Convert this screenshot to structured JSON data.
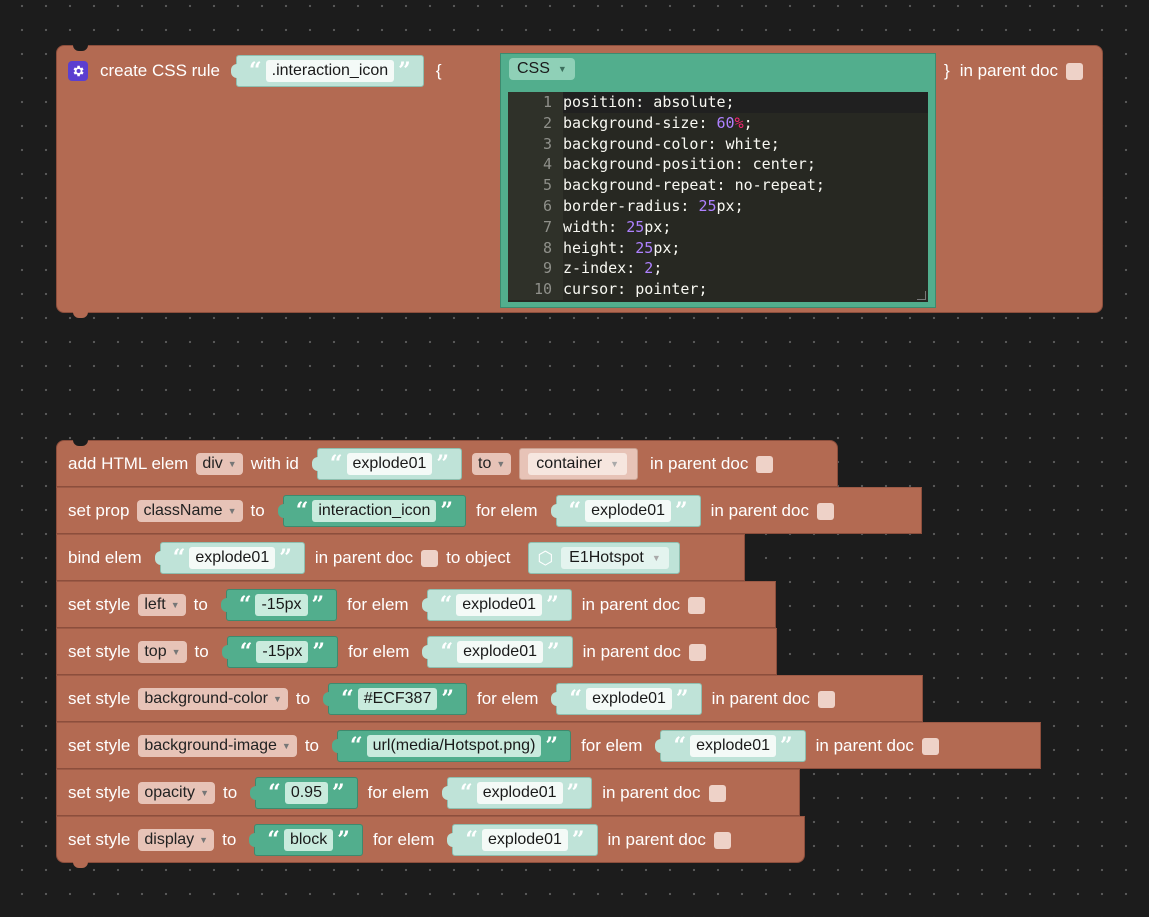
{
  "css_rule_block": {
    "label": "create CSS rule",
    "selector": ".interaction_icon",
    "open_brace": "{",
    "close_brace": "}",
    "language": "CSS",
    "in_parent_doc": "in parent doc",
    "code_lines": [
      {
        "n": "1",
        "parts": [
          [
            "t",
            "position: absolute;"
          ]
        ]
      },
      {
        "n": "2",
        "parts": [
          [
            "t",
            "background-size: "
          ],
          [
            "n",
            "60"
          ],
          [
            "p",
            "%"
          ],
          [
            "t",
            ";"
          ]
        ]
      },
      {
        "n": "3",
        "parts": [
          [
            "t",
            "background-color: white;"
          ]
        ]
      },
      {
        "n": "4",
        "parts": [
          [
            "t",
            "background-position: center;"
          ]
        ]
      },
      {
        "n": "5",
        "parts": [
          [
            "t",
            "background-repeat: no-repeat;"
          ]
        ]
      },
      {
        "n": "6",
        "parts": [
          [
            "t",
            "border-radius: "
          ],
          [
            "n",
            "25"
          ],
          [
            "t",
            "px;"
          ]
        ]
      },
      {
        "n": "7",
        "parts": [
          [
            "t",
            "width: "
          ],
          [
            "n",
            "25"
          ],
          [
            "t",
            "px;"
          ]
        ]
      },
      {
        "n": "8",
        "parts": [
          [
            "t",
            "height: "
          ],
          [
            "n",
            "25"
          ],
          [
            "t",
            "px;"
          ]
        ]
      },
      {
        "n": "9",
        "parts": [
          [
            "t",
            "z-index: "
          ],
          [
            "n",
            "2"
          ],
          [
            "t",
            ";"
          ]
        ]
      },
      {
        "n": "10",
        "parts": [
          [
            "t",
            "cursor: pointer;"
          ]
        ]
      }
    ]
  },
  "stack": {
    "add_html": {
      "label": "add HTML elem",
      "tag": "div",
      "with_id": "with id",
      "id": "explode01",
      "to": "to",
      "target": "container",
      "in_parent_doc": "in parent doc"
    },
    "set_prop": {
      "label": "set prop",
      "prop": "className",
      "to": "to",
      "value": "interaction_icon",
      "for_elem": "for elem",
      "elem": "explode01",
      "in_parent_doc": "in parent doc"
    },
    "bind_elem": {
      "label": "bind elem",
      "elem": "explode01",
      "in_parent_doc": "in parent doc",
      "to_object": "to object",
      "object": "E1Hotspot"
    },
    "styles": [
      {
        "label": "set style",
        "prop": "left",
        "to": "to",
        "value": "-15px",
        "for_elem": "for elem",
        "elem": "explode01",
        "in_parent_doc": "in parent doc"
      },
      {
        "label": "set style",
        "prop": "top",
        "to": "to",
        "value": "-15px",
        "for_elem": "for elem",
        "elem": "explode01",
        "in_parent_doc": "in parent doc"
      },
      {
        "label": "set style",
        "prop": "background-color",
        "to": "to",
        "value": "#ECF387",
        "for_elem": "for elem",
        "elem": "explode01",
        "in_parent_doc": "in parent doc"
      },
      {
        "label": "set style",
        "prop": "background-image",
        "to": "to",
        "value": "url(media/Hotspot.png)",
        "for_elem": "for elem",
        "elem": "explode01",
        "in_parent_doc": "in parent doc"
      },
      {
        "label": "set style",
        "prop": "opacity",
        "to": "to",
        "value": "0.95",
        "for_elem": "for elem",
        "elem": "explode01",
        "in_parent_doc": "in parent doc"
      },
      {
        "label": "set style",
        "prop": "display",
        "to": "to",
        "value": "block",
        "for_elem": "for elem",
        "elem": "explode01",
        "in_parent_doc": "in parent doc"
      }
    ]
  },
  "colors": {
    "block": "#b36a52",
    "text_block_light": "#bfe3d8",
    "text_block_dark": "#52ae8d",
    "editor_bg": "#272822",
    "workspace_bg": "#1c1c1c"
  },
  "icons": {
    "css_rule": "gear-icon",
    "object": "cube-icon"
  }
}
